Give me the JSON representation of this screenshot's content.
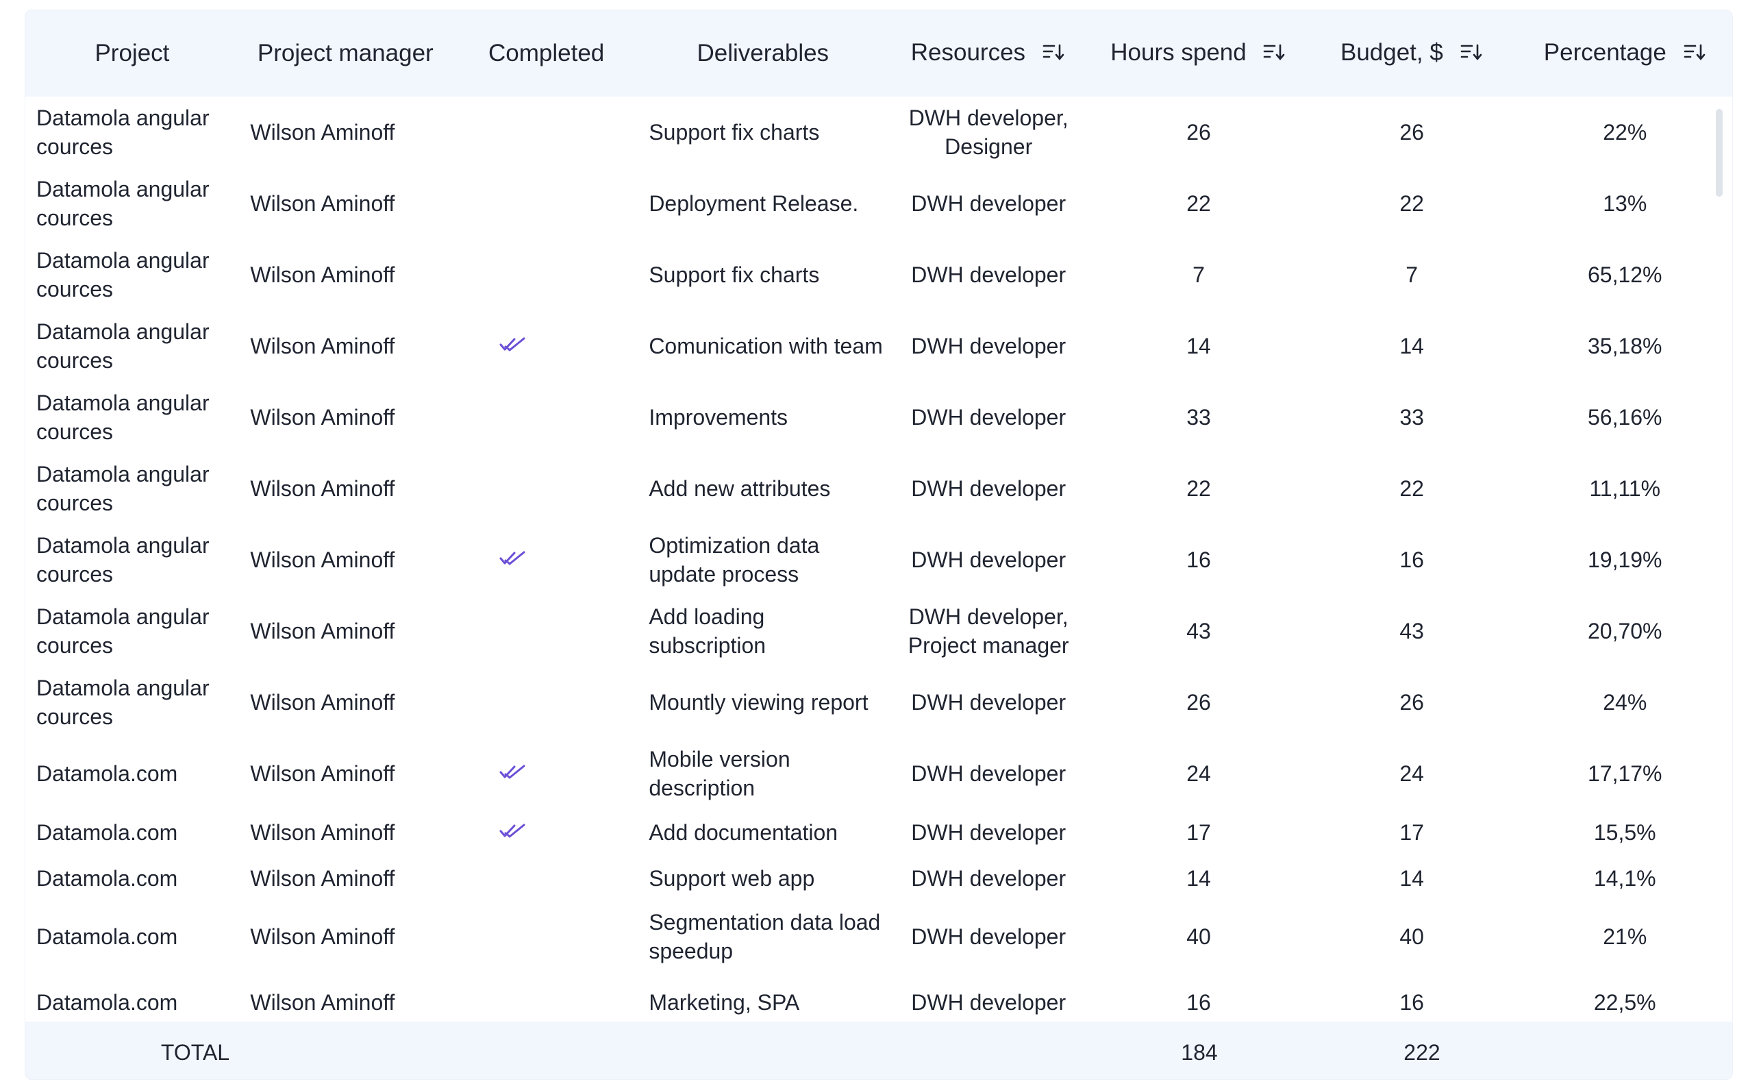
{
  "columns": {
    "project": "Project",
    "project_manager": "Project manager",
    "completed": "Completed",
    "deliverables": "Deliverables",
    "resources": "Resources",
    "hours": "Hours spend",
    "budget": "Budget, $",
    "percentage": "Percentage"
  },
  "icons": {
    "sort": "sort-icon",
    "completed": "double-check-icon"
  },
  "colors": {
    "header_bg": "#f2f6fd",
    "check": "#6b4fd6"
  },
  "rows": [
    {
      "project": "Datamola angular cources",
      "pm": "Wilson Aminoff",
      "completed": false,
      "deliverable": "Support fix charts",
      "resources": "DWH developer, Designer",
      "hours": "26",
      "budget": "26",
      "percentage": "22%"
    },
    {
      "project": "Datamola angular cources",
      "pm": "Wilson Aminoff",
      "completed": false,
      "deliverable": "Deployment Release.",
      "resources": "DWH developer",
      "hours": "22",
      "budget": "22",
      "percentage": "13%"
    },
    {
      "project": "Datamola angular cources",
      "pm": "Wilson Aminoff",
      "completed": false,
      "deliverable": "Support fix charts",
      "resources": "DWH developer",
      "hours": "7",
      "budget": "7",
      "percentage": "65,12%"
    },
    {
      "project": "Datamola angular cources",
      "pm": "Wilson Aminoff",
      "completed": true,
      "deliverable": "Comunication with team",
      "resources": "DWH developer",
      "hours": "14",
      "budget": "14",
      "percentage": "35,18%"
    },
    {
      "project": "Datamola angular cources",
      "pm": "Wilson Aminoff",
      "completed": false,
      "deliverable": "Improvements",
      "resources": "DWH developer",
      "hours": "33",
      "budget": "33",
      "percentage": "56,16%"
    },
    {
      "project": "Datamola angular cources",
      "pm": "Wilson Aminoff",
      "completed": false,
      "deliverable": "Add new attributes",
      "resources": "DWH developer",
      "hours": "22",
      "budget": "22",
      "percentage": "11,11%"
    },
    {
      "project": "Datamola angular cources",
      "pm": "Wilson Aminoff",
      "completed": true,
      "deliverable": "Optimization data update process",
      "resources": "DWH developer",
      "hours": "16",
      "budget": "16",
      "percentage": "19,19%"
    },
    {
      "project": "Datamola angular cources",
      "pm": "Wilson Aminoff",
      "completed": false,
      "deliverable": "Add loading subscription",
      "resources": "DWH developer, Project manager",
      "hours": "43",
      "budget": "43",
      "percentage": "20,70%"
    },
    {
      "project": "Datamola angular cources",
      "pm": "Wilson Aminoff",
      "completed": false,
      "deliverable": "Mountly viewing report",
      "resources": "DWH developer",
      "hours": "26",
      "budget": "26",
      "percentage": "24%"
    },
    {
      "project": "Datamola.com",
      "pm": "Wilson Aminoff",
      "completed": true,
      "deliverable": "Mobile version description",
      "resources": "DWH developer",
      "hours": "24",
      "budget": "24",
      "percentage": "17,17%"
    },
    {
      "project": "Datamola.com",
      "pm": "Wilson Aminoff",
      "completed": true,
      "deliverable": "Add documentation",
      "resources": "DWH developer",
      "hours": "17",
      "budget": "17",
      "percentage": "15,5%"
    },
    {
      "project": "Datamola.com",
      "pm": "Wilson Aminoff",
      "completed": false,
      "deliverable": "Support web app",
      "resources": "DWH developer",
      "hours": "14",
      "budget": "14",
      "percentage": "14,1%"
    },
    {
      "project": "Datamola.com",
      "pm": "Wilson Aminoff",
      "completed": false,
      "deliverable": "Segmentation data load speedup",
      "resources": "DWH developer",
      "hours": "40",
      "budget": "40",
      "percentage": "21%"
    },
    {
      "project": "Datamola.com",
      "pm": "Wilson Aminoff",
      "completed": false,
      "deliverable": "Marketing, SPA",
      "resources": "DWH developer",
      "hours": "16",
      "budget": "16",
      "percentage": "22,5%"
    }
  ],
  "total": {
    "label": "TOTAL",
    "hours": "184",
    "budget": "222"
  }
}
